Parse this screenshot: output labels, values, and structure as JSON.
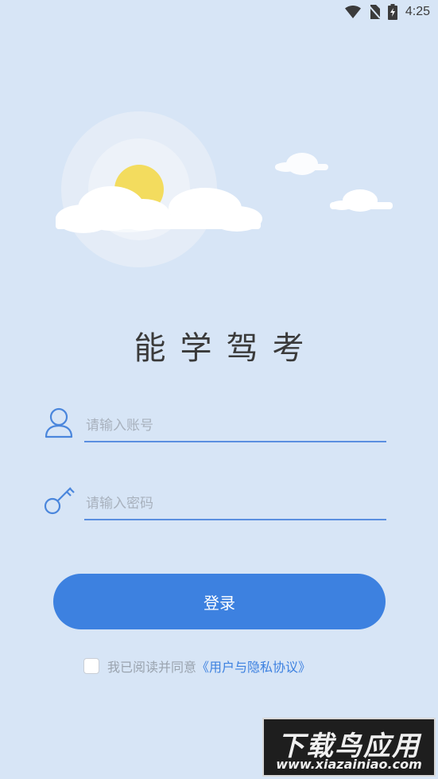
{
  "status_bar": {
    "time": "4:25"
  },
  "app": {
    "title": "能学驾考"
  },
  "login_form": {
    "account_placeholder": "请输入账号",
    "account_value": "",
    "password_placeholder": "请输入密码",
    "password_value": "",
    "login_button": "登录"
  },
  "agreement": {
    "checked": false,
    "text": "我已阅读并同意",
    "link": "《用户与隐私协议》"
  },
  "watermark": {
    "title": "下载鸟应用",
    "url": "www.xiazainiao.com"
  },
  "colors": {
    "background": "#d7e5f6",
    "accent": "#3d81e0",
    "sun": "#f3dc5e"
  }
}
